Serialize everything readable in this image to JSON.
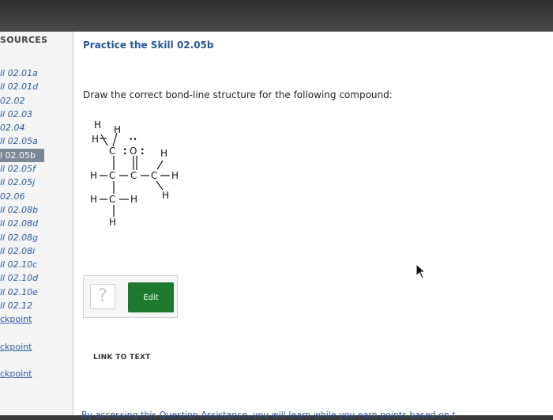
{
  "sidebar": {
    "header": "SOURCES",
    "items": [
      {
        "label": "ll 02.01a",
        "active": false
      },
      {
        "label": "ll 02.01d",
        "active": false
      },
      {
        "label": "02.02",
        "active": false
      },
      {
        "label": "ll 02.03",
        "active": false
      },
      {
        "label": "02.04",
        "active": false
      },
      {
        "label": "ll 02.05a",
        "active": false
      },
      {
        "label": "l 02.05b",
        "active": true
      },
      {
        "label": "ll 02.05f",
        "active": false
      },
      {
        "label": "ll 02.05j",
        "active": false
      },
      {
        "label": "02.06",
        "active": false
      },
      {
        "label": "ll 02.08b",
        "active": false
      },
      {
        "label": "ll 02.08d",
        "active": false
      },
      {
        "label": "ll 02.08g",
        "active": false
      },
      {
        "label": "ll 02.08i",
        "active": false
      },
      {
        "label": "ll 02.10c",
        "active": false
      },
      {
        "label": "ll 02.10d",
        "active": false
      },
      {
        "label": "ll 02.10e",
        "active": false
      },
      {
        "label": "ll 02.12",
        "active": false
      }
    ],
    "checkpoints": [
      "ckpoint",
      "ckpoint",
      "ckpoint"
    ]
  },
  "main": {
    "title": "Practice the Skill 02.05b",
    "prompt": "Draw the correct bond-line structure for the following compound:",
    "answer": {
      "placeholder_glyph": "?",
      "edit_label": "Edit"
    },
    "link_to_text": "LINK TO TEXT",
    "footer": "By accessing this Question Assistance, you will learn while you earn points based on t"
  },
  "structure": {
    "atoms": {
      "H": "H",
      "C": "C",
      "O": "O"
    },
    "lone_pairs": "••"
  },
  "colors": {
    "title": "#2a5898",
    "active_item": "#7b8896",
    "edit_button": "#1d7a2e"
  }
}
